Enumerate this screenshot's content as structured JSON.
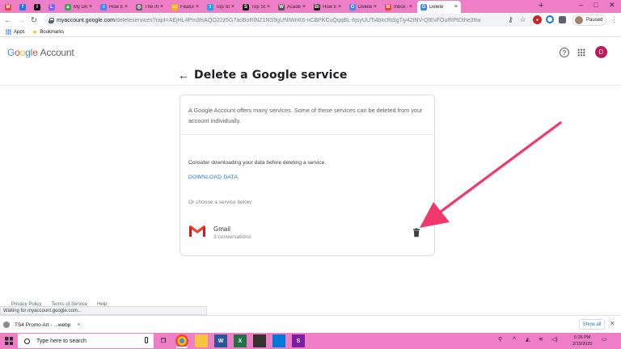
{
  "browser": {
    "tabs": [
      {
        "label": "",
        "favicon": "gmail-icon",
        "color": "#ea4335",
        "glyph": "M"
      },
      {
        "label": "",
        "favicon": "facebook-icon",
        "color": "#1877f2",
        "glyph": "f"
      },
      {
        "label": "",
        "favicon": "insider-icon",
        "color": "#111111",
        "glyph": "I"
      },
      {
        "label": "",
        "favicon": "lyft-icon",
        "color": "#7b61ff",
        "glyph": "L"
      },
      {
        "label": "My Drive",
        "favicon": "drive-icon",
        "color": "#34a853",
        "glyph": "▲"
      },
      {
        "label": "How to",
        "favicon": "docs-icon",
        "color": "#4285f4",
        "glyph": "≡"
      },
      {
        "label": "TheThin",
        "favicon": "globe-icon",
        "color": "#5f6368",
        "glyph": "◎"
      },
      {
        "label": "Feature",
        "favicon": "slides-icon",
        "color": "#f4b400",
        "glyph": "▭"
      },
      {
        "label": "Top Stor",
        "favicon": "twitter-icon",
        "color": "#1da1f2",
        "glyph": "t"
      },
      {
        "label": "Top Stor",
        "favicon": "slack-icon",
        "color": "#111111",
        "glyph": "S"
      },
      {
        "label": "Academ",
        "favicon": "wikipedia-icon",
        "color": "#555555",
        "glyph": "W"
      },
      {
        "label": "How to",
        "favicon": "bi-icon",
        "color": "#111111",
        "glyph": "BI"
      },
      {
        "label": "Delete",
        "favicon": "google-icon",
        "color": "#4285f4",
        "glyph": "G"
      },
      {
        "label": "Inbox (2",
        "favicon": "gmail-icon",
        "color": "#ea4335",
        "glyph": "M"
      },
      {
        "label": "Delete",
        "favicon": "google-icon",
        "color": "#4285f4",
        "glyph": "G",
        "active": true
      }
    ],
    "new_tab": "+",
    "url_host": "myaccount.google.com",
    "url_rest": "/deleteservices?rapt=AEjHL4Pm3fsAQO22z5G7acBoRINZ1NS9gUNIWn6S-nCBPKCuQqqBL-hjsyUUTi4bkcRiSgTiy42tNV-QfEvFOufRPtDthe3ttw",
    "profile_status": "Paused",
    "bookmarks": [
      "Apps",
      "Bookmarks"
    ]
  },
  "header": {
    "logo_google": "Google",
    "logo_account": "Account",
    "avatar_initial": "D"
  },
  "main": {
    "title": "Delete a Google service",
    "intro": "A Google Account offers many services. Some of these services can be deleted from your account individually.",
    "consider": "Consider downloading your data before deleting a service.",
    "download_link": "DOWNLOAD DATA",
    "choose": "Or choose a service below:",
    "service": {
      "name": "Gmail",
      "detail": "3 conversations"
    }
  },
  "footer": {
    "links": [
      "Privacy Policy",
      "Terms of Service",
      "Help"
    ],
    "status": "Waiting for myaccount.google.com..."
  },
  "downloads": {
    "file": "TS4 Promo Art - ...webp",
    "show_all": "Show all"
  },
  "taskbar": {
    "search_placeholder": "Type here to search",
    "time": "5:26 PM",
    "date": "2/10/2020"
  },
  "colors": {
    "accent_pink": "#ee7fc6",
    "arrow": "#f0386b",
    "link_blue": "#1a73e8"
  }
}
